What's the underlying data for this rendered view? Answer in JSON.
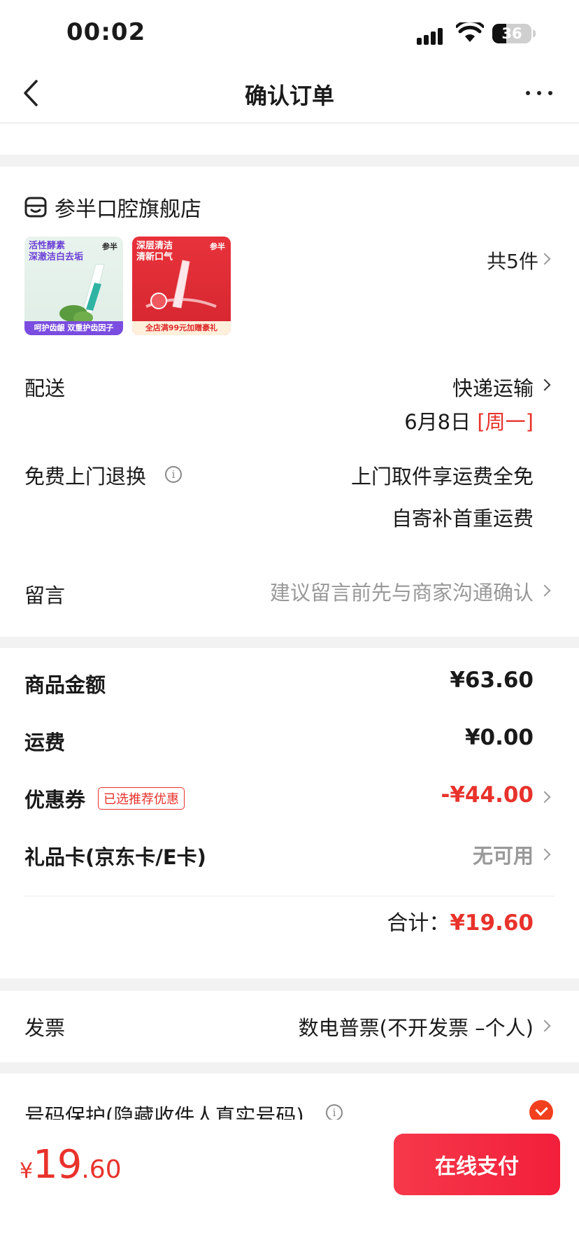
{
  "status_bar": {
    "time": "00:02",
    "battery": "36"
  },
  "nav": {
    "title": "确认订单"
  },
  "store": {
    "name": "参半口腔旗舰店",
    "item_count": "共5件",
    "thumb1": {
      "title": "活性酵素\n深澈洁白去垢",
      "brand": "参半",
      "bottom": "呵护齿龈  双重护齿因子"
    },
    "thumb2": {
      "title": "深层清洁\n清新口气",
      "brand": "参半",
      "bottom": "全店满99元加赠豪礼"
    }
  },
  "delivery": {
    "label": "配送",
    "method": "快递运输",
    "date": "6月8日",
    "weekday": "[周一]"
  },
  "return": {
    "label": "免费上门退换",
    "line1": "上门取件享运费全免",
    "line2": "自寄补首重运费"
  },
  "message": {
    "label": "留言",
    "placeholder": "建议留言前先与商家沟通确认"
  },
  "amounts": {
    "goods_label": "商品金额",
    "goods_value": "¥63.60",
    "shipping_label": "运费",
    "shipping_value": "¥0.00",
    "coupon_label": "优惠券",
    "coupon_badge": "已选推荐优惠",
    "coupon_value": "-¥44.00",
    "giftcard_label": "礼品卡(京东卡/E卡)",
    "giftcard_value": "无可用",
    "total_label": "合计：",
    "total_value": "¥19.60"
  },
  "invoice": {
    "label": "发票",
    "value": "数电普票(不开发票 –个人)"
  },
  "privacy": {
    "label": "号码保护(隐藏收件人真实号码)"
  },
  "bottom": {
    "currency": "¥",
    "price_int": "19",
    "price_dec": ".60",
    "pay_label": "在线支付"
  },
  "colors": {
    "accent_red": "#e8322b",
    "pay_button": "#f21f3b",
    "background": "#f2f2f2"
  }
}
